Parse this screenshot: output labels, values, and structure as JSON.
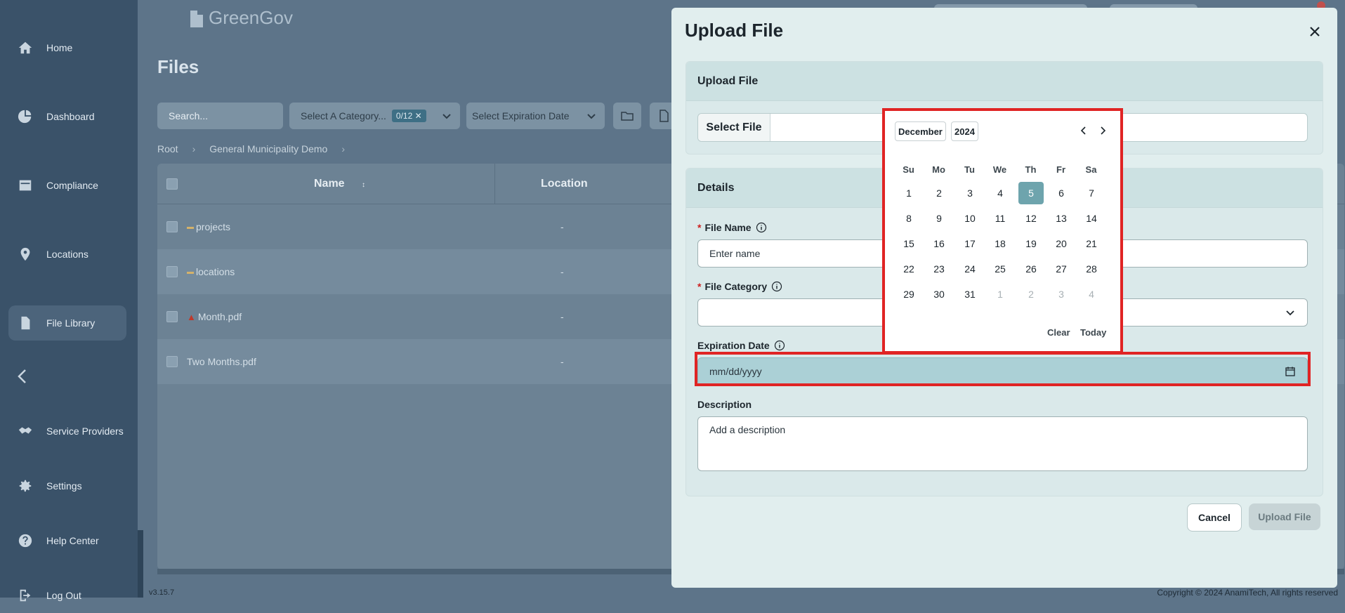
{
  "sidebar": {
    "items": [
      {
        "label": "Home",
        "icon": "home-icon"
      },
      {
        "label": "Dashboard",
        "icon": "dashboard-icon"
      },
      {
        "label": "Compliance",
        "icon": "compliance-icon"
      },
      {
        "label": "Locations",
        "icon": "location-pin-icon"
      },
      {
        "label": "File Library",
        "icon": "file-icon"
      },
      {
        "label": "Service Providers",
        "icon": "handshake-icon"
      },
      {
        "label": "Settings",
        "icon": "gear-icon"
      },
      {
        "label": "Help Center",
        "icon": "help-icon"
      },
      {
        "label": "Log Out",
        "icon": "logout-icon"
      }
    ],
    "active": "File Library"
  },
  "app": {
    "logo_text": "GreenGov"
  },
  "files_page": {
    "title": "Files",
    "search_placeholder": "Search...",
    "category_placeholder": "Select A Category...",
    "category_count": "0/12",
    "expiration_placeholder": "Select Expiration Date",
    "breadcrumb": [
      "Root",
      "General Municipality Demo"
    ],
    "columns": {
      "name": "Name",
      "location": "Location"
    },
    "rows": [
      {
        "name": "projects",
        "icon": "folder-icon",
        "location": "-"
      },
      {
        "name": "locations",
        "icon": "folder-icon",
        "location": "-"
      },
      {
        "name": "Month.pdf",
        "icon": "warning-icon",
        "location": "-"
      },
      {
        "name": "Two Months.pdf",
        "icon": "",
        "location": "-"
      }
    ]
  },
  "footer": {
    "version": "v3.15.7",
    "copyright": "Copyright © 2024 AnamiTech, All rights reserved"
  },
  "modal": {
    "title": "Upload File",
    "upload_section": {
      "title": "Upload File",
      "select_button": "Select File"
    },
    "details_section": {
      "title": "Details",
      "file_name_label": "File Name",
      "file_name_placeholder": "Enter name",
      "file_category_label": "File Category",
      "expiration_label": "Expiration Date",
      "expiration_value": "mm/dd/yyyy",
      "description_label": "Description",
      "description_placeholder": "Add a description"
    },
    "cancel_label": "Cancel",
    "upload_label": "Upload File"
  },
  "datepicker": {
    "month": "December",
    "year": "2024",
    "weekdays": [
      "Su",
      "Mo",
      "Tu",
      "We",
      "Th",
      "Fr",
      "Sa"
    ],
    "weeks": [
      [
        "1",
        "2",
        "3",
        "4",
        "5",
        "6",
        "7"
      ],
      [
        "8",
        "9",
        "10",
        "11",
        "12",
        "13",
        "14"
      ],
      [
        "15",
        "16",
        "17",
        "18",
        "19",
        "20",
        "21"
      ],
      [
        "22",
        "23",
        "24",
        "25",
        "26",
        "27",
        "28"
      ],
      [
        "29",
        "30",
        "31",
        "1",
        "2",
        "3",
        "4"
      ]
    ],
    "selected_day": "5",
    "clear_label": "Clear",
    "today_label": "Today"
  },
  "colors": {
    "accent": "#6ea4ad",
    "highlight": "#e02424",
    "sidebar": "#3a5269"
  }
}
